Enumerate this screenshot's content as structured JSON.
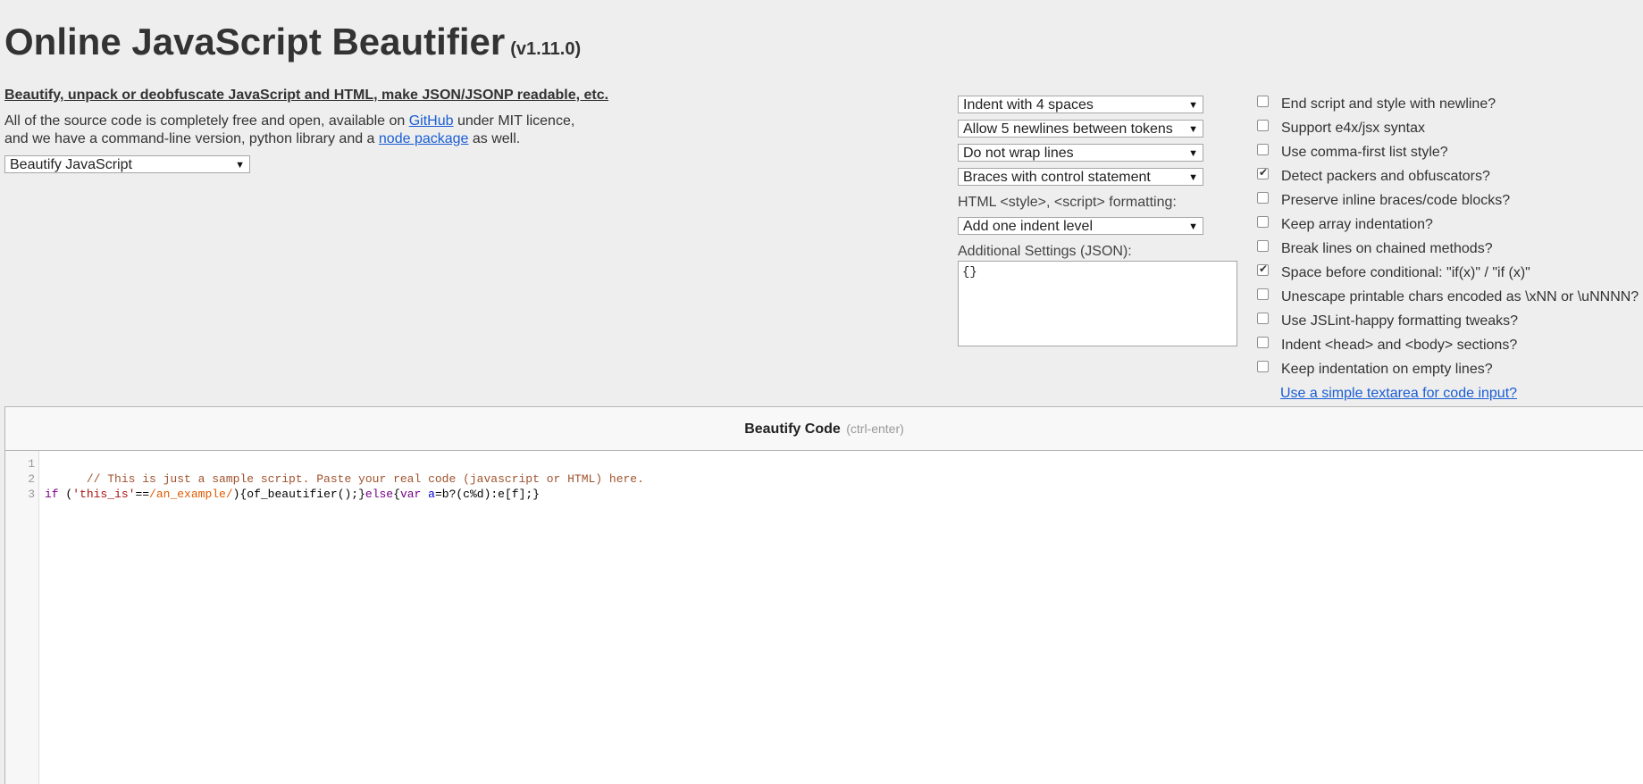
{
  "header": {
    "title": "Online JavaScript Beautifier",
    "version": "(v1.11.0)",
    "subtitle": "Beautify, unpack or deobfuscate JavaScript and HTML, make JSON/JSONP readable, etc."
  },
  "intro": {
    "line1_a": "All of the source code is completely free and open, available on ",
    "github_link": "GitHub",
    "line1_b": " under MIT licence,",
    "line2_a": "and we have a command-line version, python library and a ",
    "node_link": "node package",
    "line2_b": " as well."
  },
  "mode_select": {
    "value": "Beautify JavaScript"
  },
  "options": {
    "indent": "Indent with 4 spaces",
    "newlines": "Allow 5 newlines between tokens",
    "wrap": "Do not wrap lines",
    "braces": "Braces with control statement",
    "html_label": "HTML <style>, <script> formatting:",
    "html_indent": "Add one indent level",
    "json_label": "Additional Settings (JSON):",
    "json_value": "{}"
  },
  "checkboxes": [
    {
      "label": "End script and style with newline?",
      "checked": false
    },
    {
      "label": "Support e4x/jsx syntax",
      "checked": false
    },
    {
      "label": "Use comma-first list style?",
      "checked": false
    },
    {
      "label": "Detect packers and obfuscators?",
      "checked": true
    },
    {
      "label": "Preserve inline braces/code blocks?",
      "checked": false
    },
    {
      "label": "Keep array indentation?",
      "checked": false
    },
    {
      "label": "Break lines on chained methods?",
      "checked": false
    },
    {
      "label": "Space before conditional: \"if(x)\" / \"if (x)\"",
      "checked": true
    },
    {
      "label": "Unescape printable chars encoded as \\xNN or \\uNNNN?",
      "checked": false
    },
    {
      "label": "Use JSLint-happy formatting tweaks?",
      "checked": false
    },
    {
      "label": "Indent <head> and <body> sections?",
      "checked": false
    },
    {
      "label": "Keep indentation on empty lines?",
      "checked": false
    }
  ],
  "textarea_link": "Use a simple textarea for code input?",
  "beautify_button": {
    "label": "Beautify Code",
    "hint": "(ctrl-enter)"
  },
  "editor": {
    "line_numbers": [
      "1",
      "2",
      "3"
    ],
    "line1": "// This is just a sample script. Paste your real code (javascript or HTML) here.",
    "line3": {
      "t1": "if",
      "t2": " (",
      "t3": "'this_is'",
      "t4": "==",
      "t5": "/an_example/",
      "t6": "){of_beautifier();}",
      "t7": "else",
      "t8": "{",
      "t9": "var",
      "t10": " ",
      "t11": "a",
      "t12": "=b?(c%d):e[f];}"
    }
  }
}
